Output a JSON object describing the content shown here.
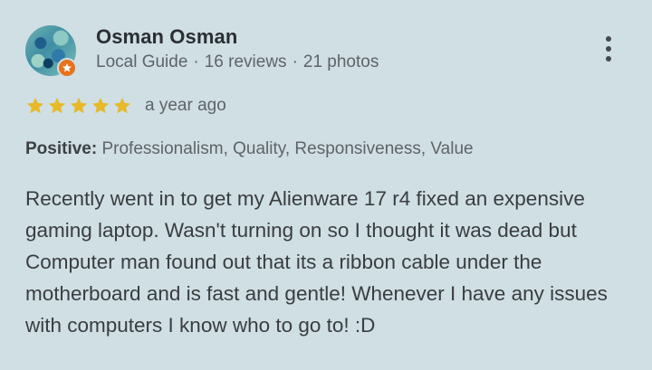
{
  "reviewer": {
    "name": "Osman Osman",
    "role": "Local Guide",
    "reviews": "16 reviews",
    "photos": "21 photos",
    "separator": "·"
  },
  "rating": {
    "stars": 5,
    "max": 5,
    "star_color": "#e8b928",
    "time_ago": "a year ago"
  },
  "attributes": {
    "label": "Positive:",
    "values": "Professionalism, Quality, Responsiveness, Value"
  },
  "review_text": "Recently went in to get my Alienware 17 r4 fixed an expensive gaming laptop. Wasn't turning on so I thought it was dead but Computer man found out that its a ribbon cable under the motherboard and is fast and gentle! Whenever I have any issues with computers I know who to go to! :D",
  "icons": {
    "avatar": "profile-photo",
    "badge": "local-guide-badge-icon",
    "menu": "more-vert-icon",
    "star": "star-icon"
  },
  "colors": {
    "background": "#cfdfe4",
    "badge": "#e8711c"
  }
}
